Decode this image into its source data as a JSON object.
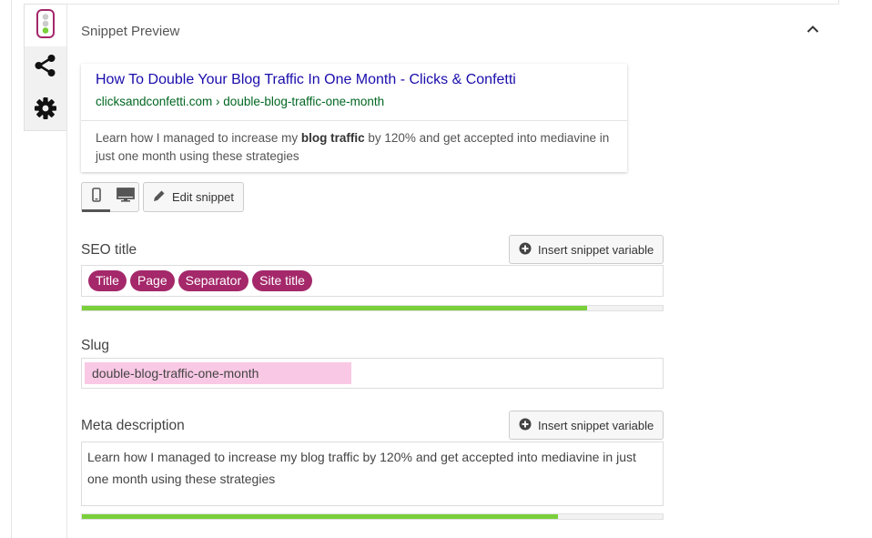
{
  "sidebar": {
    "items": [
      {
        "name": "seo-analysis-tab",
        "icon": "traffic-light-icon"
      },
      {
        "name": "social-tab",
        "icon": "share-icon"
      },
      {
        "name": "advanced-tab",
        "icon": "gear-icon"
      }
    ]
  },
  "section": {
    "title": "Snippet Preview"
  },
  "preview": {
    "title": "How To Double Your Blog Traffic In One Month - Clicks & Confetti",
    "url": "clicksandconfetti.com › double-blog-traffic-one-month",
    "desc_before": "Learn how I managed to increase my ",
    "desc_bold": "blog traffic",
    "desc_after": " by 120% and get accepted into mediavine in just one month using these strategies"
  },
  "toolbar": {
    "edit_snippet_label": "Edit snippet"
  },
  "seo_title": {
    "label": "SEO title",
    "insert_variable_label": "Insert snippet variable",
    "tokens": [
      "Title",
      "Page",
      "Separator",
      "Site title"
    ],
    "progress": 0.87
  },
  "slug": {
    "label": "Slug",
    "value": "double-blog-traffic-one-month"
  },
  "meta_description": {
    "label": "Meta description",
    "insert_variable_label": "Insert snippet variable",
    "value": "Learn how I managed to increase my blog traffic by 120% and get accepted into mediavine in just one month using these strategies",
    "progress": 0.82
  },
  "colors": {
    "accent": "#a4286a",
    "progress_good": "#7ad03a",
    "link_title": "#1a0dab",
    "link_url": "#006621",
    "slug_highlight": "#f9c8e4"
  }
}
